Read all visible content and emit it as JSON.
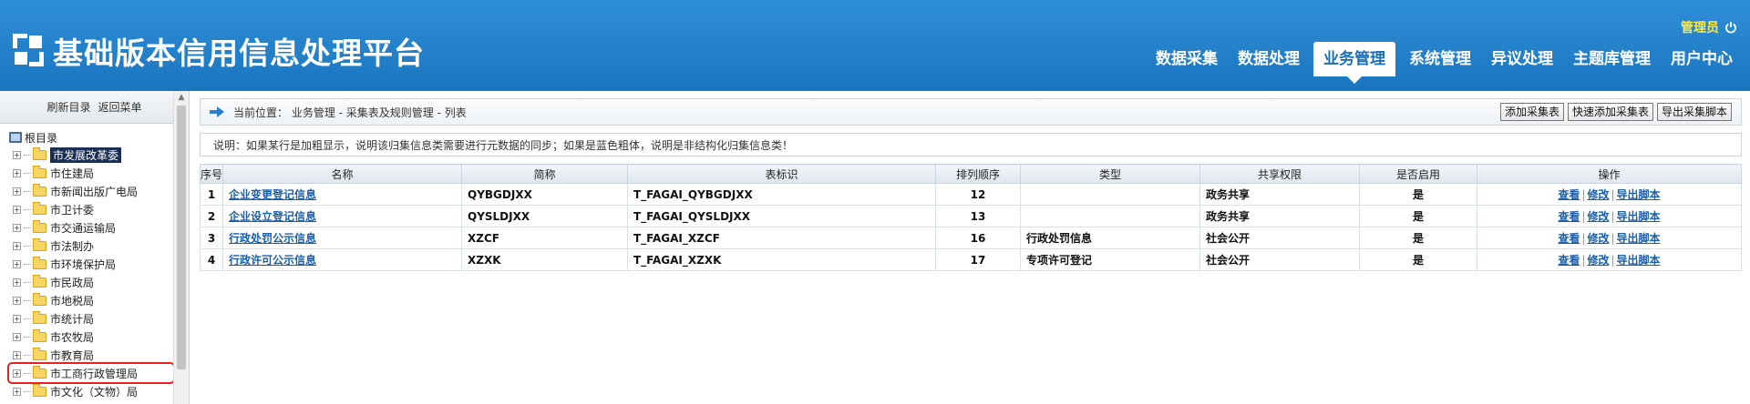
{
  "app": {
    "title": "基础版本信用信息处理平台",
    "user": "管理员",
    "icons": {
      "logo": "logo-icon",
      "power": "power-icon"
    }
  },
  "nav": {
    "items": [
      {
        "label": "数据采集"
      },
      {
        "label": "数据处理"
      },
      {
        "label": "业务管理",
        "active": true
      },
      {
        "label": "系统管理"
      },
      {
        "label": "异议处理"
      },
      {
        "label": "主题库管理"
      },
      {
        "label": "用户中心"
      }
    ]
  },
  "sidebar": {
    "refresh_label": "刷新目录",
    "back_label": "返回菜单",
    "root_label": "根目录",
    "items": [
      {
        "label": "市发展改革委"
      },
      {
        "label": "市住建局"
      },
      {
        "label": "市新闻出版广电局"
      },
      {
        "label": "市卫计委"
      },
      {
        "label": "市交通运输局"
      },
      {
        "label": "市法制办"
      },
      {
        "label": "市环境保护局"
      },
      {
        "label": "市民政局"
      },
      {
        "label": "市地税局"
      },
      {
        "label": "市统计局"
      },
      {
        "label": "市农牧局"
      },
      {
        "label": "市教育局"
      },
      {
        "label": "市工商行政管理局"
      },
      {
        "label": "市文化（文物）局"
      }
    ]
  },
  "breadcrumb": {
    "text": "当前位置： 业务管理 - 采集表及规则管理 - 列表",
    "buttons": {
      "add": "添加采集表",
      "quick_add": "快速添加采集表",
      "export": "导出采集脚本"
    }
  },
  "note": "说明：如果某行是加粗显示，说明该归集信息类需要进行元数据的同步；如果是蓝色粗体，说明是非结构化归集信息类！",
  "table": {
    "headers": [
      "序号",
      "名称",
      "简称",
      "表标识",
      "排列顺序",
      "类型",
      "共享权限",
      "是否启用",
      "操作"
    ],
    "rows": [
      {
        "no": "1",
        "name": "企业变更登记信息",
        "short": "QYBGDJXX",
        "table_id": "T_FAGAI_QYBGDJXX",
        "order": "12",
        "type": "",
        "share": "政务共享",
        "enabled": "是"
      },
      {
        "no": "2",
        "name": "企业设立登记信息",
        "short": "QYSLDJXX",
        "table_id": "T_FAGAI_QYSLDJXX",
        "order": "13",
        "type": "",
        "share": "政务共享",
        "enabled": "是"
      },
      {
        "no": "3",
        "name": "行政处罚公示信息",
        "short": "XZCF",
        "table_id": "T_FAGAI_XZCF",
        "order": "16",
        "type": "行政处罚信息",
        "share": "社会公开",
        "enabled": "是"
      },
      {
        "no": "4",
        "name": "行政许可公示信息",
        "short": "XZXK",
        "table_id": "T_FAGAI_XZXK",
        "order": "17",
        "type": "专项许可登记",
        "share": "社会公开",
        "enabled": "是"
      }
    ],
    "ops": {
      "view": "查看",
      "edit": "修改",
      "export": "导出脚本"
    }
  }
}
